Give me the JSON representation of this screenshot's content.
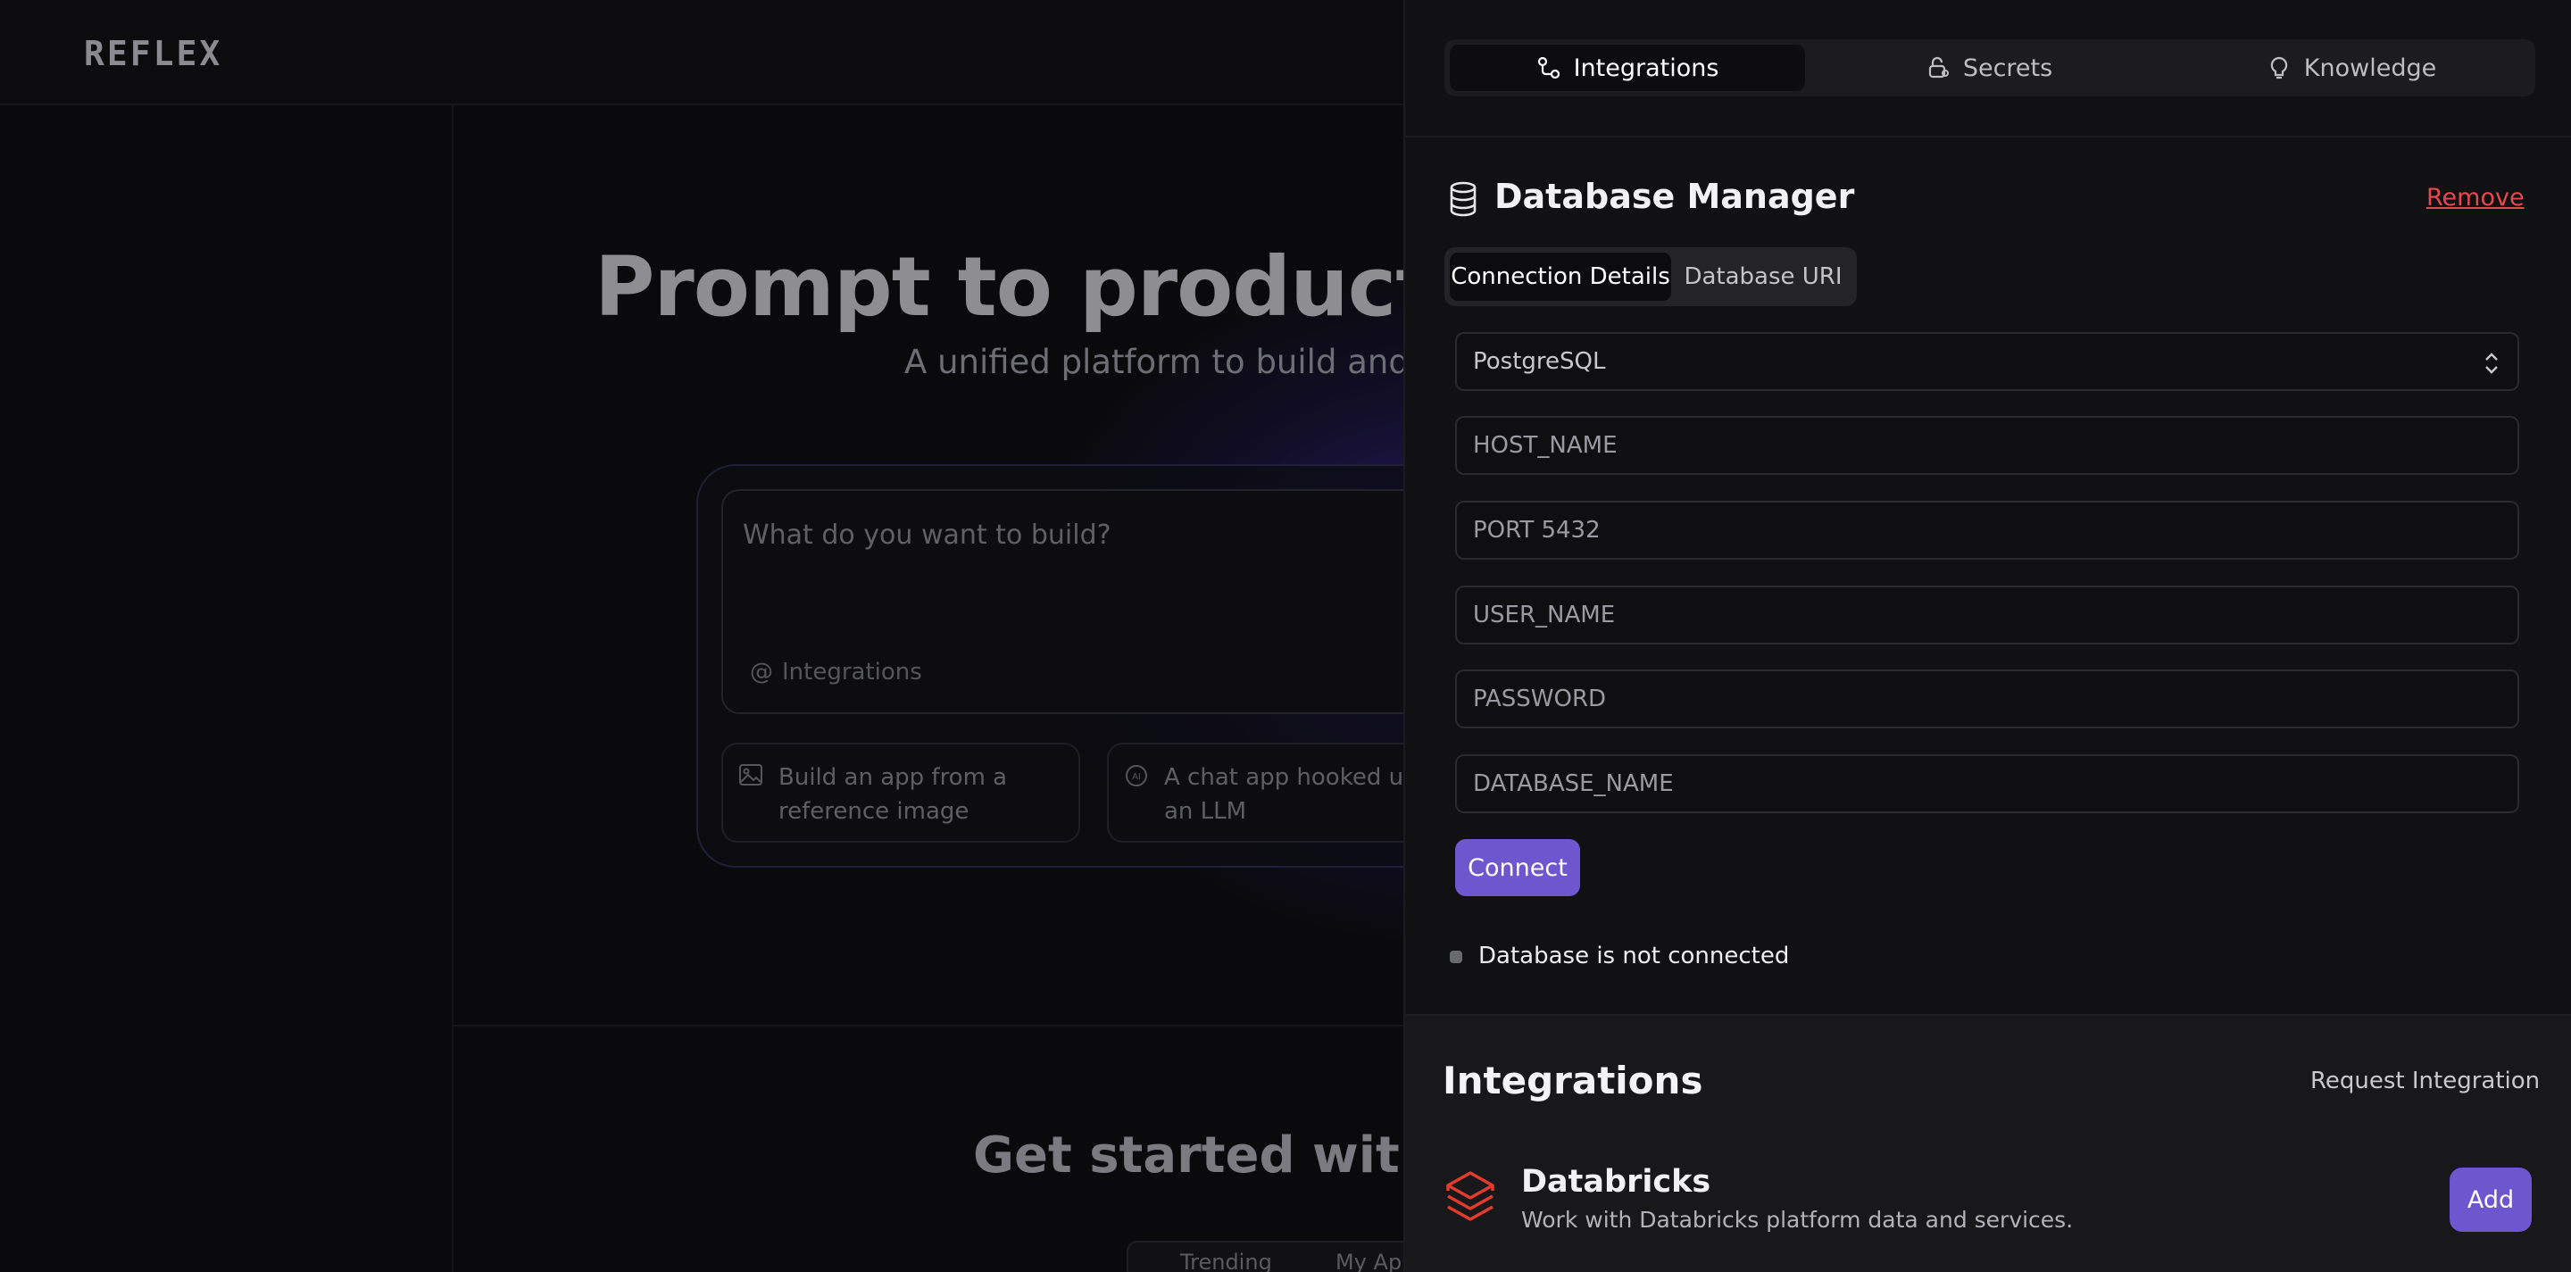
{
  "background": {
    "logo": "REFLEX",
    "hero_title": "Prompt to production",
    "hero_subtitle": "A unified platform to build and de",
    "prompt_placeholder": "What do you want to build?",
    "prompt_integrations": "Integrations",
    "suggestions": [
      {
        "icon": "image-icon",
        "text": "Build an app from a reference image"
      },
      {
        "icon": "ai-icon",
        "text": "A chat app hooked up t an LLM"
      }
    ],
    "get_started": "Get started with a t",
    "template_tabs": [
      "Trending",
      "My Ap"
    ]
  },
  "drawer": {
    "tabs": [
      {
        "label": "Integrations",
        "icon": "integrations-icon",
        "active": true
      },
      {
        "label": "Secrets",
        "icon": "lock-icon",
        "active": false
      },
      {
        "label": "Knowledge",
        "icon": "knowledge-icon",
        "active": false
      }
    ],
    "db_manager": {
      "title": "Database Manager",
      "remove_label": "Remove",
      "segments": [
        {
          "label": "Connection Details",
          "active": true
        },
        {
          "label": "Database URI",
          "active": false
        }
      ],
      "db_type": "PostgreSQL",
      "fields": {
        "host_placeholder": "HOST_NAME",
        "port_placeholder": "PORT 5432",
        "user_placeholder": "USER_NAME",
        "password_placeholder": "PASSWORD",
        "dbname_placeholder": "DATABASE_NAME"
      },
      "connect_label": "Connect",
      "status_text": "Database is not connected"
    },
    "integrations": {
      "title": "Integrations",
      "request_label": "Request Integration",
      "items": [
        {
          "name": "Databricks",
          "description": "Work with Databricks platform data and services.",
          "add_label": "Add",
          "icon": "databricks-icon"
        }
      ]
    }
  },
  "colors": {
    "accent": "#6e56cf",
    "danger": "#e5484d",
    "drawer_bg": "#111113"
  }
}
